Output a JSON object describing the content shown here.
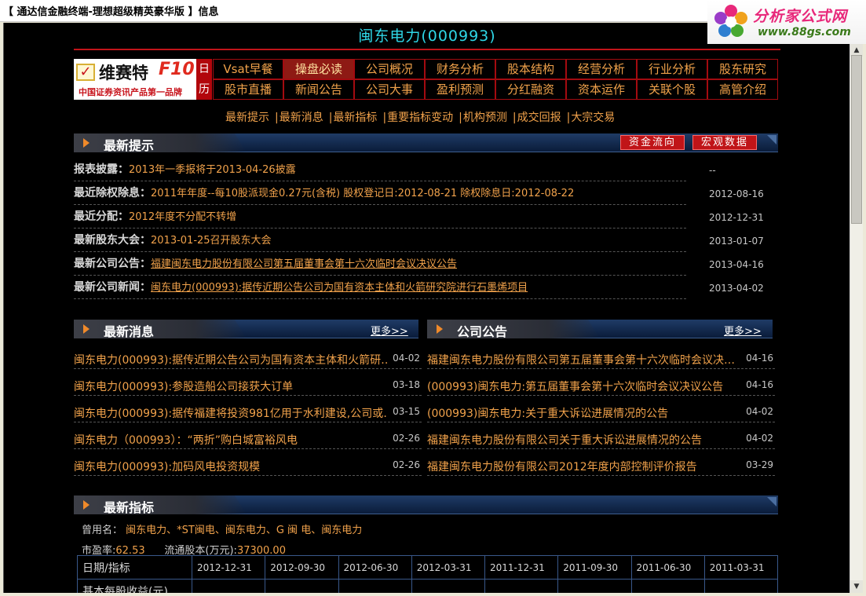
{
  "window": {
    "title": "【 通达信金融终端-理想超级精英豪华版 】信息"
  },
  "brand": {
    "name": "分析家公式网",
    "url": "www.88gs.com"
  },
  "stock": {
    "title": "闽东电力(000993)"
  },
  "logo": {
    "name": "维赛特",
    "f10": "F10",
    "slogan": "中国证券资讯产品第一品牌",
    "calendar_top": "日",
    "calendar_bottom": "历"
  },
  "nav": {
    "row1": [
      "Vsat早餐",
      "操盘必读",
      "公司概况",
      "财务分析",
      "股本结构",
      "经营分析",
      "行业分析",
      "股东研究"
    ],
    "row2": [
      "股市直播",
      "新闻公告",
      "公司大事",
      "盈利预测",
      "分红融资",
      "资本运作",
      "关联个股",
      "高管介绍"
    ],
    "active": "操盘必读"
  },
  "sublinks": [
    "最新提示",
    "最新消息",
    "最新指标",
    "重要指标变动",
    "机构预测",
    "成交回报",
    "大宗交易"
  ],
  "tips": {
    "header": "最新提示",
    "btn_fund": "资金流向",
    "btn_macro": "宏观数据",
    "rows": [
      {
        "label": "报表披露：",
        "value": "2013年一季报将于2013-04-26披露",
        "date": "--"
      },
      {
        "label": "最近除权除息：",
        "value": "2011年年度--每10股派现金0.27元(含税) 股权登记日:2012-08-21 除权除息日:2012-08-22",
        "date": "2012-08-16"
      },
      {
        "label": "最近分配：",
        "value": "2012年度不分配不转增",
        "date": "2012-12-31"
      },
      {
        "label": "最新股东大会：",
        "value": "2013-01-25召开股东大会",
        "date": "2013-01-07"
      },
      {
        "label": "最新公司公告：",
        "value": "福建闽东电力股份有限公司第五届董事会第十六次临时会议决议公告",
        "date": "2013-04-16"
      },
      {
        "label": "最新公司新闻：",
        "value": "闽东电力(000993):据传近期公告公司为国有资本主体和火箭研究院进行石墨烯项目",
        "date": "2013-04-02"
      }
    ]
  },
  "news": {
    "header": "最新消息",
    "more": "更多>>",
    "items": [
      {
        "title": "闽东电力(000993):据传近期公告公司为国有资本主体和火箭研…",
        "date": "04-02"
      },
      {
        "title": "闽东电力(000993):参股造船公司接获大订单",
        "date": "03-18"
      },
      {
        "title": "闽东电力(000993):据传福建将投资981亿用于水利建设,公司或…",
        "date": "03-15"
      },
      {
        "title": "闽东电力（000993）：“两折”购白城富裕风电",
        "date": "02-26"
      },
      {
        "title": "闽东电力(000993):加码风电投资规模",
        "date": "02-26"
      }
    ]
  },
  "announcements": {
    "header": "公司公告",
    "more": "更多>>",
    "items": [
      {
        "title": "福建闽东电力股份有限公司第五届董事会第十六次临时会议决…",
        "date": "04-16"
      },
      {
        "title": "(000993)闽东电力:第五届董事会第十六次临时会议决议公告",
        "date": "04-16"
      },
      {
        "title": "(000993)闽东电力:关于重大诉讼进展情况的公告",
        "date": "04-02"
      },
      {
        "title": "福建闽东电力股份有限公司关于重大诉讼进展情况的公告",
        "date": "04-02"
      },
      {
        "title": "福建闽东电力股份有限公司2012年度内部控制评价报告",
        "date": "03-29"
      }
    ]
  },
  "indicators": {
    "header": "最新指标",
    "former_names_label": "曾用名：",
    "former_names": "闽东电力、*ST闽电、闽东电力、G 闽 电、闽东电力",
    "pe_label": "市盈率:",
    "pe": "62.53",
    "float_label": "流通股本(万元):",
    "float_shares": "37300.00",
    "table_header": [
      "日期/指标",
      "2012-12-31",
      "2012-09-30",
      "2012-06-30",
      "2012-03-31",
      "2011-12-31",
      "2011-09-30",
      "2011-06-30",
      "2011-03-31"
    ],
    "row2_label": "基本每股收益(元)"
  }
}
